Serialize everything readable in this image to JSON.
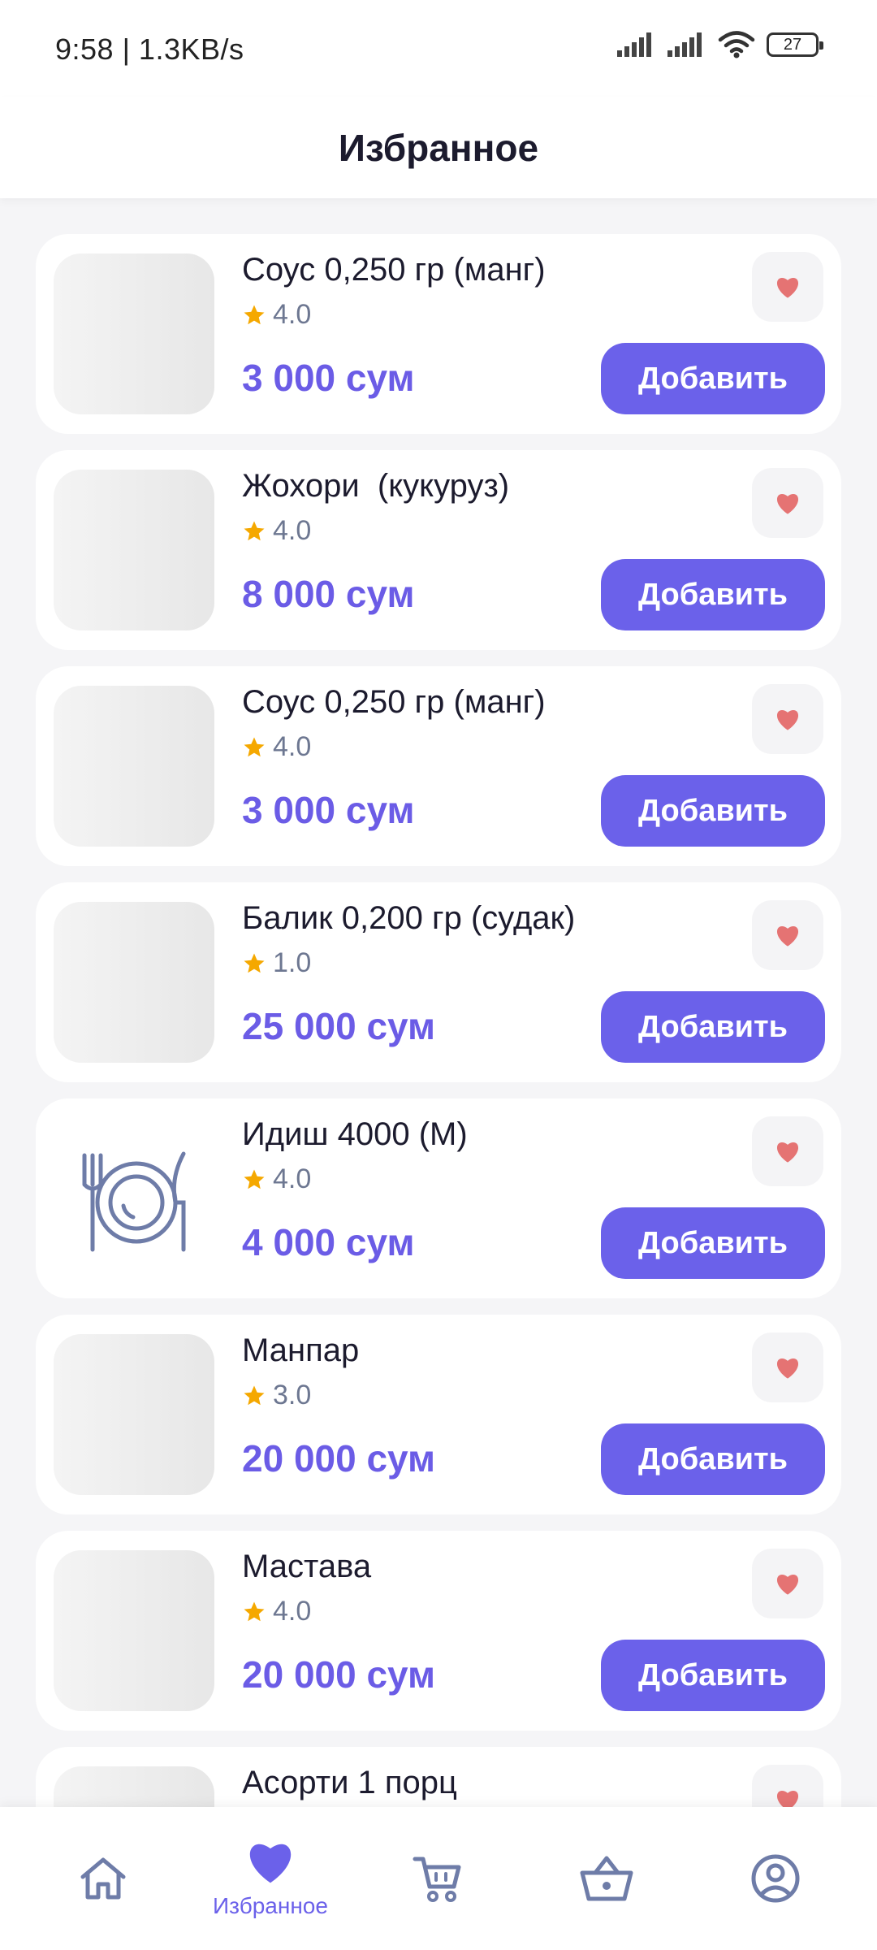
{
  "status": {
    "time": "9:58 | 1.3KB/s",
    "battery": "27"
  },
  "header": {
    "title": "Избранное"
  },
  "colors": {
    "accent": "#6b61ea",
    "price": "#6b5ce6",
    "heart": "#e57373",
    "star": "#f5a800"
  },
  "items": [
    {
      "title": "Соус 0,250 гр (манг)",
      "rating": "4.0",
      "price": "3 000 сум",
      "button": "Добавить"
    },
    {
      "title": "Жохори  (кукуруз)",
      "rating": "4.0",
      "price": "8 000 сум",
      "button": "Добавить"
    },
    {
      "title": "Соус 0,250 гр (манг)",
      "rating": "4.0",
      "price": "3 000 сум",
      "button": "Добавить"
    },
    {
      "title": "Балик 0,200 гр (судак)",
      "rating": "1.0",
      "price": "25 000 сум",
      "button": "Добавить"
    },
    {
      "title": "Идиш 4000 (М)",
      "rating": "4.0",
      "price": "4 000 сум",
      "button": "Добавить"
    },
    {
      "title": "Манпар",
      "rating": "3.0",
      "price": "20 000 сум",
      "button": "Добавить"
    },
    {
      "title": "Мастава",
      "rating": "4.0",
      "price": "20 000 сум",
      "button": "Добавить"
    },
    {
      "title": "Асорти 1 порц",
      "rating": "",
      "price": "",
      "button": ""
    }
  ],
  "nav": {
    "favorites_label": "Избранное",
    "icons": [
      "home-icon",
      "heart-icon",
      "cart-icon",
      "basket-icon",
      "profile-icon"
    ]
  }
}
